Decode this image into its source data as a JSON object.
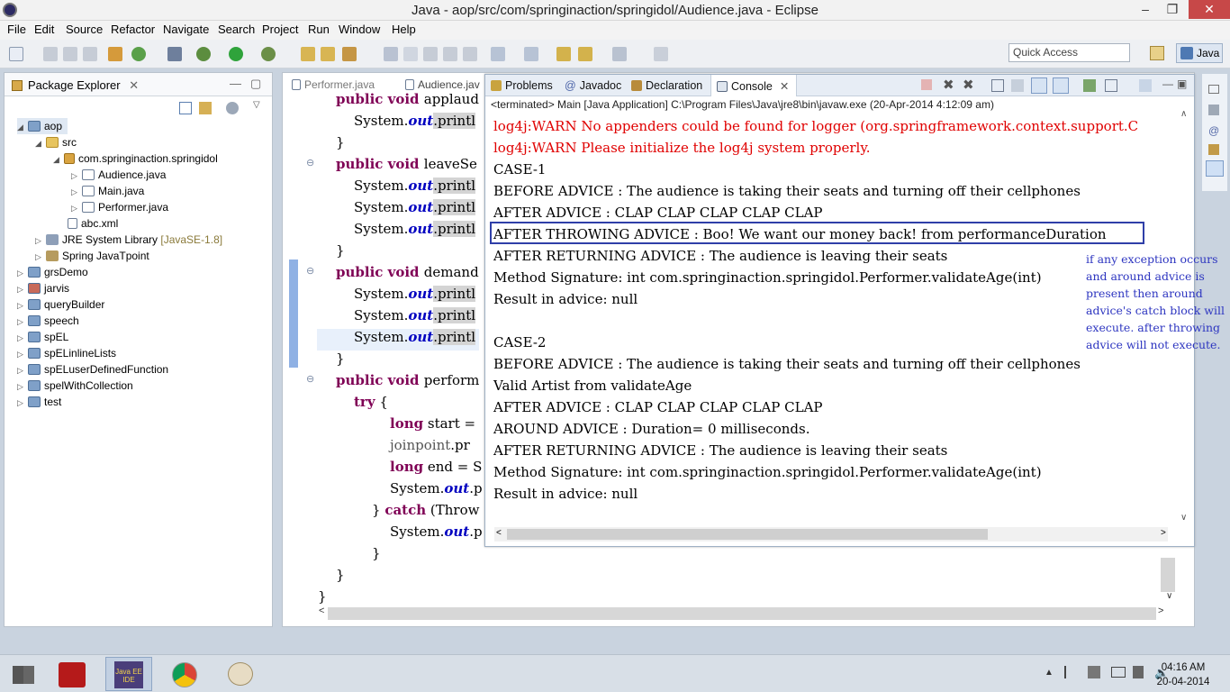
{
  "window": {
    "title": "Java - aop/src/com/springinaction/springidol/Audience.java - Eclipse",
    "min": "–",
    "max": "❐",
    "close": "✕"
  },
  "menu": [
    "File",
    "Edit",
    "Source",
    "Refactor",
    "Navigate",
    "Search",
    "Project",
    "Run",
    "Window",
    "Help"
  ],
  "toolbar": {
    "quick_access": "Quick Access",
    "perspective": "Java"
  },
  "package_explorer": {
    "title": "Package Explorer",
    "tree": [
      {
        "label": "aop",
        "extra": ""
      },
      {
        "label": "src",
        "extra": ""
      },
      {
        "label": "com.springinaction.springidol",
        "extra": ""
      },
      {
        "label": "Audience.java",
        "extra": ""
      },
      {
        "label": "Main.java",
        "extra": ""
      },
      {
        "label": "Performer.java",
        "extra": ""
      },
      {
        "label": "abc.xml",
        "extra": ""
      },
      {
        "label": "JRE System Library",
        "extra": "[JavaSE-1.8]"
      },
      {
        "label": "Spring JavaTpoint",
        "extra": ""
      },
      {
        "label": "grsDemo",
        "extra": ""
      },
      {
        "label": "jarvis",
        "extra": ""
      },
      {
        "label": "queryBuilder",
        "extra": ""
      },
      {
        "label": "speech",
        "extra": ""
      },
      {
        "label": "spEL",
        "extra": ""
      },
      {
        "label": "spELinlineLists",
        "extra": ""
      },
      {
        "label": "spELuserDefinedFunction",
        "extra": ""
      },
      {
        "label": "spelWithCollection",
        "extra": ""
      },
      {
        "label": "test",
        "extra": ""
      }
    ]
  },
  "editor": {
    "tabs": [
      "Performer.java",
      "Audience.jav"
    ],
    "lines": {
      "l1": [
        "public void ",
        "applaud"
      ],
      "l2": [
        "System.",
        "out",
        ".printl"
      ],
      "l3": "}",
      "l4": [
        "public void ",
        "leaveSe"
      ],
      "l5": [
        "System.",
        "out",
        ".printl"
      ],
      "l6": [
        "System.",
        "out",
        ".printl"
      ],
      "l7": [
        "System.",
        "out",
        ".printl"
      ],
      "l8": "}",
      "l9": [
        "public void ",
        "demand"
      ],
      "l10": [
        "System.",
        "out",
        ".printl"
      ],
      "l11": [
        "System.",
        "out",
        ".printl"
      ],
      "l12": [
        "System.",
        "out",
        ".printl"
      ],
      "l13": "}",
      "l14": [
        "public void ",
        "perform"
      ],
      "l15": [
        "try",
        " {"
      ],
      "l16": [
        "long",
        " start = "
      ],
      "l17": [
        "joinpoint",
        ".pr"
      ],
      "l18": [
        "long",
        " end = S"
      ],
      "l19": [
        "System.",
        "out",
        ".p"
      ],
      "l20": [
        "} ",
        "catch",
        " (Throw"
      ],
      "l21": [
        "System.",
        "out",
        ".p"
      ],
      "l22": "}",
      "l23": "}",
      "l24": "}"
    }
  },
  "console": {
    "tabs": [
      "Problems",
      "Javadoc",
      "Declaration",
      "Console"
    ],
    "status": "<terminated> Main [Java Application] C:\\Program Files\\Java\\jre8\\bin\\javaw.exe (20-Apr-2014 4:12:09 am)",
    "lines": [
      "log4j:WARN No appenders could be found for logger (org.springframework.context.support.C",
      "log4j:WARN Please initialize the log4j system properly.",
      "CASE-1",
      "BEFORE ADVICE : The audience is taking their seats and turning off their cellphones",
      "AFTER ADVICE : CLAP CLAP CLAP CLAP CLAP",
      "AFTER THROWING ADVICE : Boo! We want our money back! from performanceDuration",
      "AFTER RETURNING ADVICE : The audience is leaving their seats",
      "Method Signature: int com.springinaction.springidol.Performer.validateAge(int)",
      "Result in advice: null",
      "",
      "CASE-2",
      "BEFORE ADVICE : The audience is taking their seats and turning off their cellphones",
      "Valid Artist from validateAge",
      "AFTER ADVICE : CLAP CLAP CLAP CLAP CLAP",
      "AROUND ADVICE : Duration= 0 milliseconds.",
      "AFTER RETURNING ADVICE : The audience is leaving their seats",
      "Method Signature: int com.springinaction.springidol.Performer.validateAge(int)",
      "Result in advice: null"
    ]
  },
  "note": "if any exception occurs and around advice is present then around advice's catch block will execute. after throwing advice will not execute.",
  "taskbar": {
    "time": "04:16 AM",
    "date": "20-04-2014",
    "java_label": "Java EE IDE"
  },
  "colors": {
    "keyword": "#7f0055",
    "field": "#0000c0",
    "error": "#e00000",
    "annotation": "#2d35c0",
    "highlight_border": "#2f3fa8"
  }
}
